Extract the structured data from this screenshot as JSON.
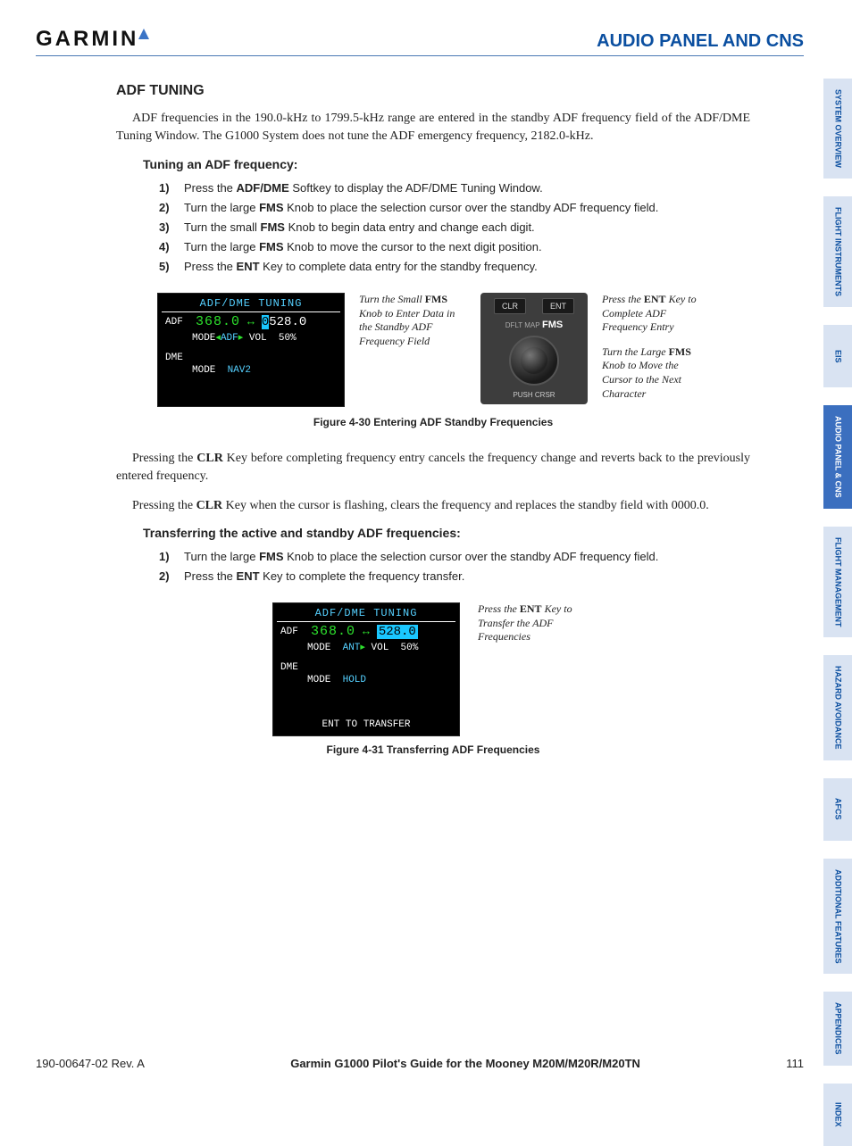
{
  "header": {
    "logo_text": "GARMIN",
    "title": "AUDIO PANEL AND CNS"
  },
  "tabs": [
    {
      "label": "SYSTEM\nOVERVIEW",
      "active": false
    },
    {
      "label": "FLIGHT\nINSTRUMENTS",
      "active": false
    },
    {
      "label": "EIS",
      "active": false
    },
    {
      "label": "AUDIO PANEL\n& CNS",
      "active": true
    },
    {
      "label": "FLIGHT\nMANAGEMENT",
      "active": false
    },
    {
      "label": "HAZARD\nAVOIDANCE",
      "active": false
    },
    {
      "label": "AFCS",
      "active": false
    },
    {
      "label": "ADDITIONAL\nFEATURES",
      "active": false
    },
    {
      "label": "APPENDICES",
      "active": false
    },
    {
      "label": "INDEX",
      "active": false
    }
  ],
  "section": {
    "heading": "ADF Tuning",
    "intro": "ADF frequencies in the 190.0-kHz to 1799.5-kHz range are entered in the standby ADF frequency field of the ADF/DME Tuning Window.  The G1000 System does not tune the ADF emergency frequency, 2182.0-kHz.",
    "tuning_h": "Tuning an ADF frequency:",
    "steps1": [
      {
        "n": "1)",
        "pre": "Press the ",
        "bold": "ADF/DME",
        "post": " Softkey to display the ADF/DME Tuning Window."
      },
      {
        "n": "2)",
        "pre": "Turn the large ",
        "bold": "FMS",
        "post": " Knob to place the selection cursor over the standby ADF frequency field."
      },
      {
        "n": "3)",
        "pre": "Turn the small ",
        "bold": "FMS",
        "post": " Knob to begin data entry and change each digit."
      },
      {
        "n": "4)",
        "pre": "Turn the large ",
        "bold": "FMS",
        "post": " Knob to move the cursor to the next digit position."
      },
      {
        "n": "5)",
        "pre": "Press the ",
        "bold": "ENT",
        "post": " Key to complete data entry for the standby frequency."
      }
    ],
    "fig1": {
      "window_title": "ADF/DME TUNING",
      "adf_label": "ADF",
      "active_freq": "368.0",
      "arrow": "↔",
      "standby_freq": "0528.0",
      "mode_line": "MODE◂ADF▸ VOL  50%",
      "dme_label": "DME",
      "dme_mode": "MODE  NAV2",
      "anno_small": "Turn the Small FMS Knob to Enter Data in the Standby ADF Frequency Field",
      "clr": "CLR",
      "ent": "ENT",
      "dflt": "DFLT MAP",
      "fms": "FMS",
      "push": "PUSH CRSR",
      "anno_ent": "Press the ENT Key to Complete ADF Frequency Entry",
      "anno_large": "Turn the Large FMS Knob to Move the Cursor to the Next Character",
      "caption": "Figure 4-30  Entering ADF Standby Frequencies"
    },
    "para_clr1": "Pressing the CLR Key before completing frequency entry cancels the frequency change and reverts back to the previously entered frequency.",
    "para_clr2": "Pressing the CLR Key when the cursor is flashing, clears the frequency and replaces the standby field with 0000.0.",
    "transfer_h": "Transferring the active and standby ADF frequencies:",
    "steps2": [
      {
        "n": "1)",
        "pre": "Turn the large ",
        "bold": "FMS",
        "post": " Knob to place the selection cursor over the standby ADF frequency field."
      },
      {
        "n": "2)",
        "pre": "Press the ",
        "bold": "ENT",
        "post": " Key to complete the frequency transfer."
      }
    ],
    "fig2": {
      "window_title": "ADF/DME TUNING",
      "adf_label": "ADF",
      "active_freq": "368.0",
      "arrow": "↔",
      "standby_freq": "528.0",
      "mode_line": "MODE  ANT▸ VOL  50%",
      "dme_label": "DME",
      "dme_mode": "MODE  HOLD",
      "foot": "ENT TO TRANSFER",
      "anno": "Press the ENT Key to Transfer the ADF Frequencies",
      "caption": "Figure 4-31  Transferring ADF Frequencies"
    }
  },
  "footer": {
    "left": "190-00647-02  Rev. A",
    "mid": "Garmin G1000 Pilot's Guide for the Mooney M20M/M20R/M20TN",
    "page": "111"
  }
}
